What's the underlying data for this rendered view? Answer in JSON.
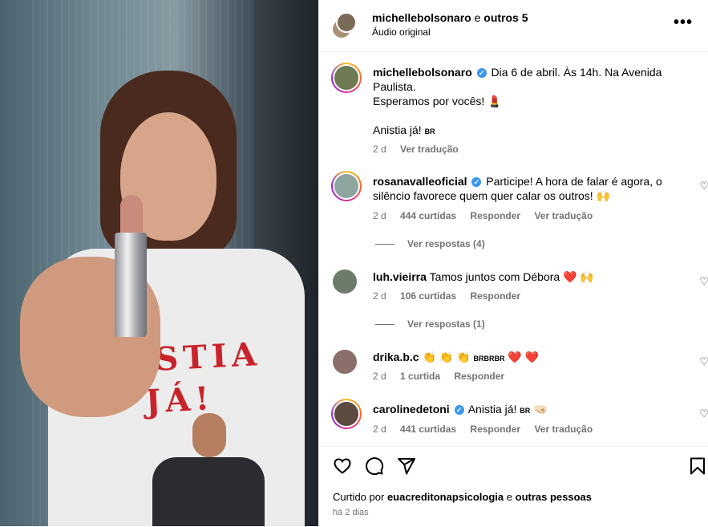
{
  "header": {
    "username": "michellebolsonaro",
    "joiner": "e",
    "others": "outros 5",
    "audio": "Áudio original"
  },
  "caption": {
    "username": "michellebolsonaro",
    "line1": "Dia 6 de abril. Às 14h. Na Avenida Paulista.",
    "line2": "Esperamos por vocês! 💄",
    "line3": "Anistia já!",
    "flag": "BR",
    "time": "2 d",
    "translate": "Ver tradução"
  },
  "comments": [
    {
      "username": "rosanavalleoficial",
      "verified": true,
      "text": "Participe! A hora de falar é agora, o silêncio favorece quem quer calar os outros! 🙌",
      "time": "2 d",
      "likes": "444 curtidas",
      "reply": "Responder",
      "translate": "Ver tradução",
      "view_replies": "Ver respostas (4)"
    },
    {
      "username": "luh.vieirra",
      "verified": false,
      "text": "Tamos juntos com Débora ❤️ 🙌",
      "time": "2 d",
      "likes": "106 curtidas",
      "reply": "Responder",
      "view_replies": "Ver respostas (1)"
    },
    {
      "username": "drika.b.c",
      "verified": false,
      "text_prefix": "👏 👏 👏",
      "flag": "BRBRBR",
      "text_suffix": "❤️ ❤️",
      "time": "2 d",
      "likes": "1 curtida",
      "reply": "Responder"
    },
    {
      "username": "carolinedetoni",
      "verified": true,
      "text": "Anistia já!",
      "flag": "BR",
      "emoji": "🤜🏻",
      "time": "2 d",
      "likes": "441 curtidas",
      "reply": "Responder",
      "translate": "Ver tradução"
    }
  ],
  "footer": {
    "liked_by_prefix": "Curtido por",
    "liked_by_user": "euacreditonapsicologia",
    "liked_by_joiner": "e",
    "liked_by_suffix": "outras pessoas",
    "ago": "há 2 dias"
  },
  "media": {
    "shirt_text_line1": "ISTIA",
    "shirt_text_line2": "JÁ!"
  },
  "colors": {
    "verified": "#3897f0",
    "muted": "#737373",
    "heart": "#ed1c24"
  },
  "icons": [
    "more-icon",
    "heart-icon",
    "comment-icon",
    "share-icon",
    "bookmark-icon",
    "verified-icon"
  ]
}
